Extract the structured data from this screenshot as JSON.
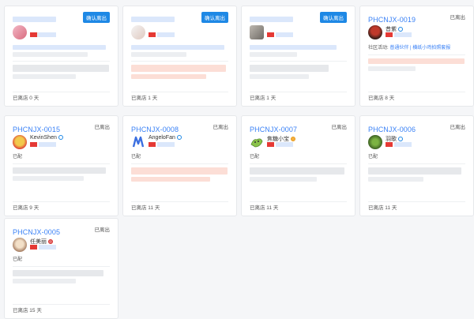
{
  "cards": [
    {
      "code": "",
      "tag": "确认离出",
      "footer": "已离店 0 天"
    },
    {
      "code": "",
      "tag": "确认离出",
      "footer": "已离店 1 天"
    },
    {
      "code": "",
      "tag": "确认离出",
      "footer": "已离店 1 天"
    },
    {
      "code": "PHCNJX-0019",
      "tag": "已离出",
      "username": "昔紫",
      "activity_prefix": "社区活动:",
      "activity_link": "普通伙伴 | 横纸小鸡拍照套报",
      "footer": "已离店 8 天"
    },
    {
      "code": "PHCNJX-0015",
      "tag": "已离出",
      "username": "KevinShen",
      "status": "已配",
      "footer": "已离店 9 天"
    },
    {
      "code": "PHCNJX-0008",
      "tag": "已离出",
      "username": "AngeloFan",
      "status": "已配",
      "footer": "已离店 11 天"
    },
    {
      "code": "PHCNJX-0007",
      "tag": "已离出",
      "username": "焦糖小宝",
      "status": "已配",
      "footer": "已离店 11 天"
    },
    {
      "code": "PHCNJX-0006",
      "tag": "已离出",
      "username": "羽歌",
      "status": "已配",
      "footer": "已离店 11 天"
    },
    {
      "code": "PHCNJX-0005",
      "tag": "已离出",
      "username": "任美丽",
      "status": "已配",
      "footer": "已离店 15 天"
    }
  ],
  "colors": {
    "accent": "#3b82f6",
    "tag_button": "#1e88e5",
    "flag": "#e53935"
  }
}
